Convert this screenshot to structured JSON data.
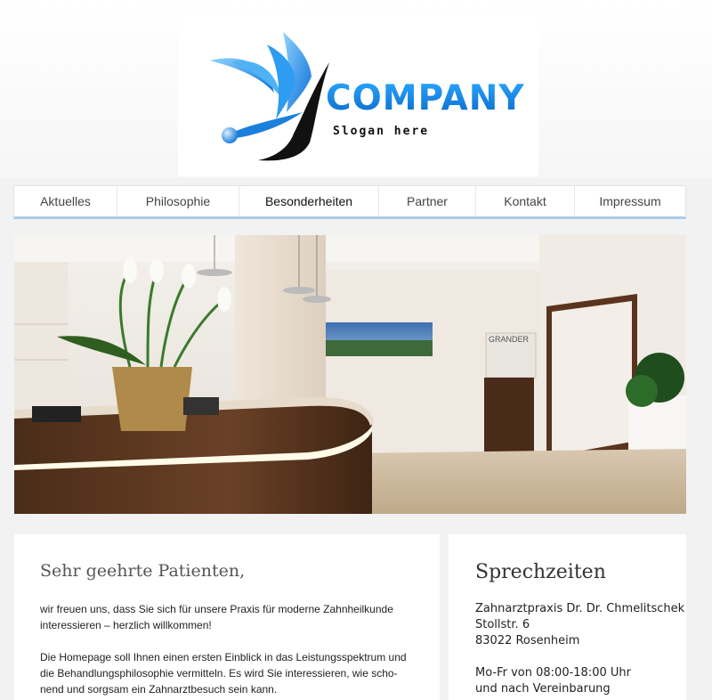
{
  "header": {
    "logo_word": "COMPANY",
    "logo_slogan": "Slogan here"
  },
  "nav": {
    "items": [
      "Aktuelles",
      "Philosophie",
      "Besonderheiten",
      "Partner",
      "Kontakt",
      "Impressum"
    ],
    "active": "Besonderheiten"
  },
  "hero": {
    "sign_text": "GRANDER"
  },
  "welcome": {
    "title": "Sehr geehrte Patienten,",
    "para1_line1": "wir freuen uns, dass Sie sich für unsere Praxis für moderne Zahnheilkunde",
    "para1_line2": "interessieren – herzlich willkommen!",
    "para2_line1": "Die Homepage soll Ihnen einen ersten Einblick in das Leistungsspektrum und",
    "para2_line2": "die Behandlungsphilosophie vermitteln. Es wird Sie interessieren, wie scho-",
    "para2_line3": "nend und sorgsam ein Zahnarztbesuch sein kann."
  },
  "hours": {
    "title": "Sprechzeiten",
    "practice": "Zahnarztpraxis Dr. Dr. Chmelitschek",
    "street": "Stollstr. 6",
    "city": "83022 Rosenheim",
    "times": "Mo-Fr von 08:00-18:00 Uhr",
    "appointment": "und nach Vereinbarung"
  },
  "colors": {
    "accent": "#1e90e8",
    "nav_border": "#a9cce8"
  }
}
